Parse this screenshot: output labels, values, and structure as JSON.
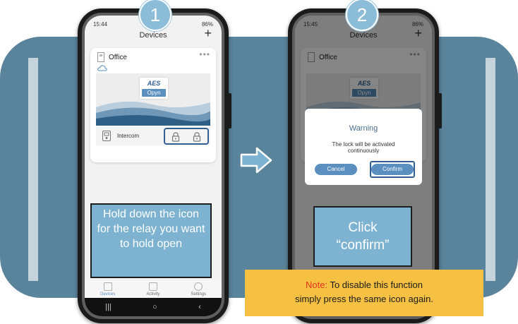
{
  "header": {
    "title_fragment": ""
  },
  "steps": [
    {
      "number": "1"
    },
    {
      "number": "2"
    }
  ],
  "phone1": {
    "status_time": "15:44",
    "status_right": "86%",
    "app_title": "Devices",
    "add_symbol": "+",
    "card": {
      "name": "Office",
      "menu": "•••",
      "logo_top": "AES",
      "logo_bottom": "Opyn",
      "intercom_label": "Intercom"
    },
    "tabs": [
      {
        "label": "Devices"
      },
      {
        "label": "Activity"
      },
      {
        "label": "Settings"
      }
    ],
    "nav": {
      "recent": "|||",
      "home": "○",
      "back": "‹"
    },
    "callout_text": "Hold down the icon for the relay you want to hold open"
  },
  "phone2": {
    "status_time": "15:45",
    "status_right": "86%",
    "app_title": "Devices",
    "add_symbol": "+",
    "card_name": "Office",
    "card_menu": "•••",
    "logo_top": "AES",
    "logo_bottom": "Opyn",
    "dialog": {
      "title": "Warning",
      "message": "The lock will be activated continuously",
      "cancel_label": "Cancel",
      "confirm_label": "Confirm"
    },
    "callout_text": "Click “confirm”"
  },
  "note": {
    "prefix": "Note:",
    "text": "To disable this function",
    "line2": "simply press the same icon again."
  },
  "colors": {
    "band": "#5a849c",
    "callout": "#7db3d1",
    "accent": "#5a8fbf",
    "note_bg": "#f6c143",
    "note_prefix": "#e0311b"
  }
}
